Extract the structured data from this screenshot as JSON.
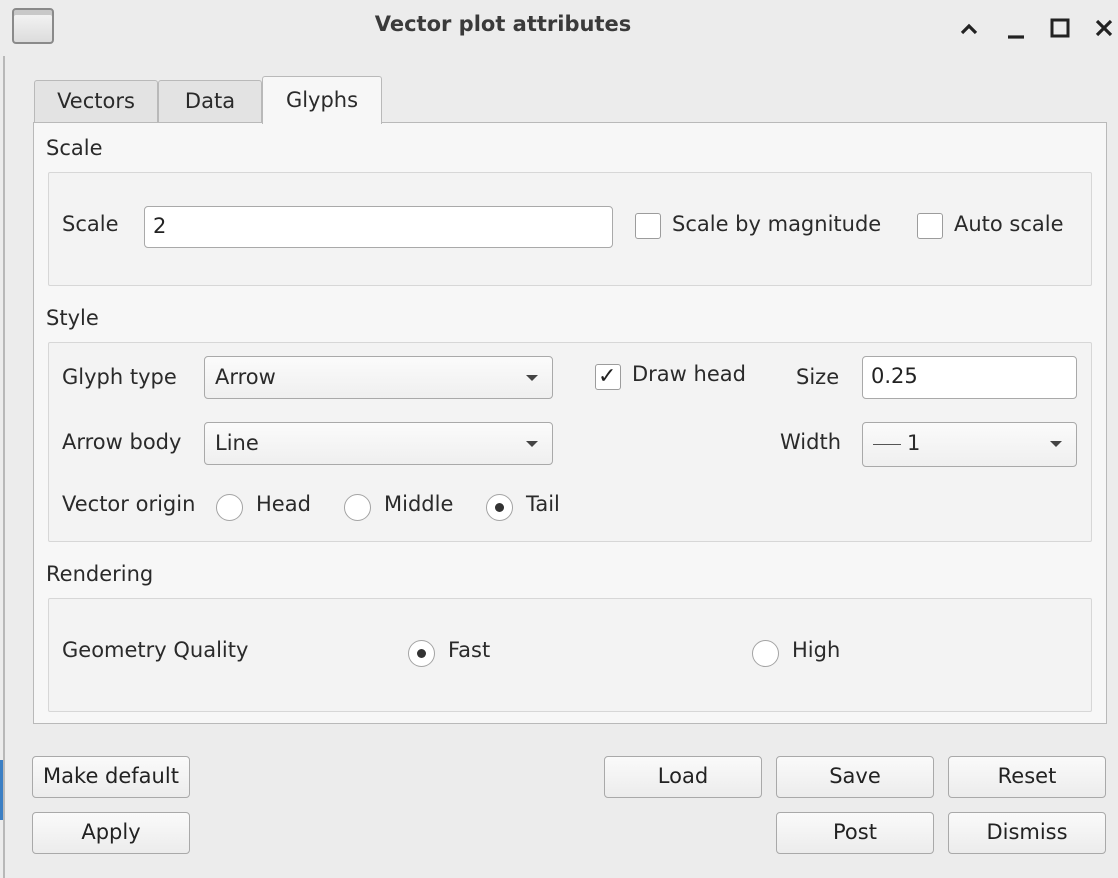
{
  "window": {
    "title": "Vector plot attributes"
  },
  "tabs": [
    {
      "label": "Vectors",
      "active": false
    },
    {
      "label": "Data",
      "active": false
    },
    {
      "label": "Glyphs",
      "active": true
    }
  ],
  "scale_section": {
    "label": "Scale",
    "scale_label": "Scale",
    "scale_value": "2",
    "scale_by_magnitude": {
      "label": "Scale by magnitude",
      "checked": false
    },
    "auto_scale": {
      "label": "Auto scale",
      "checked": false
    }
  },
  "style_section": {
    "label": "Style",
    "glyph_type_label": "Glyph type",
    "glyph_type_value": "Arrow",
    "draw_head": {
      "label": "Draw head",
      "checked": true
    },
    "size_label": "Size",
    "size_value": "0.25",
    "arrow_body_label": "Arrow body",
    "arrow_body_value": "Line",
    "width_label": "Width",
    "width_value": "1",
    "vector_origin_label": "Vector origin",
    "origin_options": [
      {
        "label": "Head",
        "selected": false
      },
      {
        "label": "Middle",
        "selected": false
      },
      {
        "label": "Tail",
        "selected": true
      }
    ]
  },
  "rendering_section": {
    "label": "Rendering",
    "geometry_quality_label": "Geometry Quality",
    "quality_options": [
      {
        "label": "Fast",
        "selected": true
      },
      {
        "label": "High",
        "selected": false
      }
    ]
  },
  "buttons": {
    "make_default": "Make default",
    "apply": "Apply",
    "load": "Load",
    "save": "Save",
    "reset": "Reset",
    "post": "Post",
    "dismiss": "Dismiss"
  }
}
